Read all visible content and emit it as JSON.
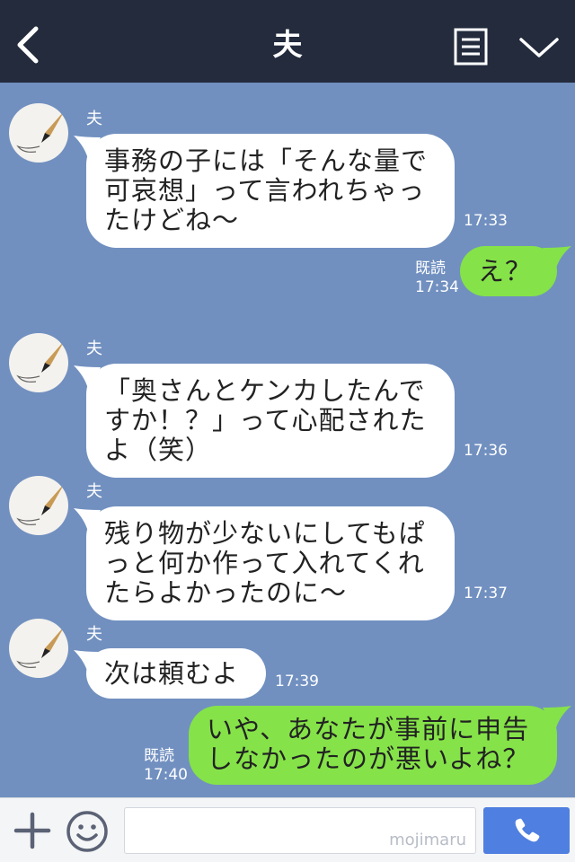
{
  "header": {
    "title": "夫",
    "back_icon": "chevron-left-icon",
    "menu_icon": "list-icon",
    "more_icon": "chevron-down-icon"
  },
  "messages": [
    {
      "sender": "夫",
      "lines": [
        "事務の子には「そんな量で",
        "可哀想」って言われちゃっ",
        "たけどね〜"
      ],
      "time": "17:33"
    },
    {
      "read": "既読",
      "time": "17:34",
      "lines": [
        "え？"
      ]
    },
    {
      "sender": "夫",
      "lines": [
        "「奥さんとケンカしたんで",
        "すか！？」って心配された",
        "よ（笑）"
      ],
      "time": "17:36"
    },
    {
      "sender": "夫",
      "lines": [
        "残り物が少ないにしてもぱ",
        "っと何か作って入れてくれ",
        "たらよかったのに〜"
      ],
      "time": "17:37"
    },
    {
      "sender": "夫",
      "lines": [
        "次は頼むよ"
      ],
      "time": "17:39"
    },
    {
      "read": "既読",
      "time": "17:40",
      "lines": [
        "いや、あなたが事前に申告",
        "しなかったのが悪いよね？"
      ]
    }
  ],
  "footer": {
    "plus_icon": "plus-icon",
    "emoji_icon": "smile-icon",
    "input_value": "",
    "watermark": "mojimaru",
    "call_icon": "phone-icon"
  },
  "colors": {
    "header_bg": "#232b3d",
    "chat_bg": "#7190c0",
    "incoming_bubble": "#ffffff",
    "outgoing_bubble": "#85e249",
    "call_button": "#4f7fe0"
  }
}
